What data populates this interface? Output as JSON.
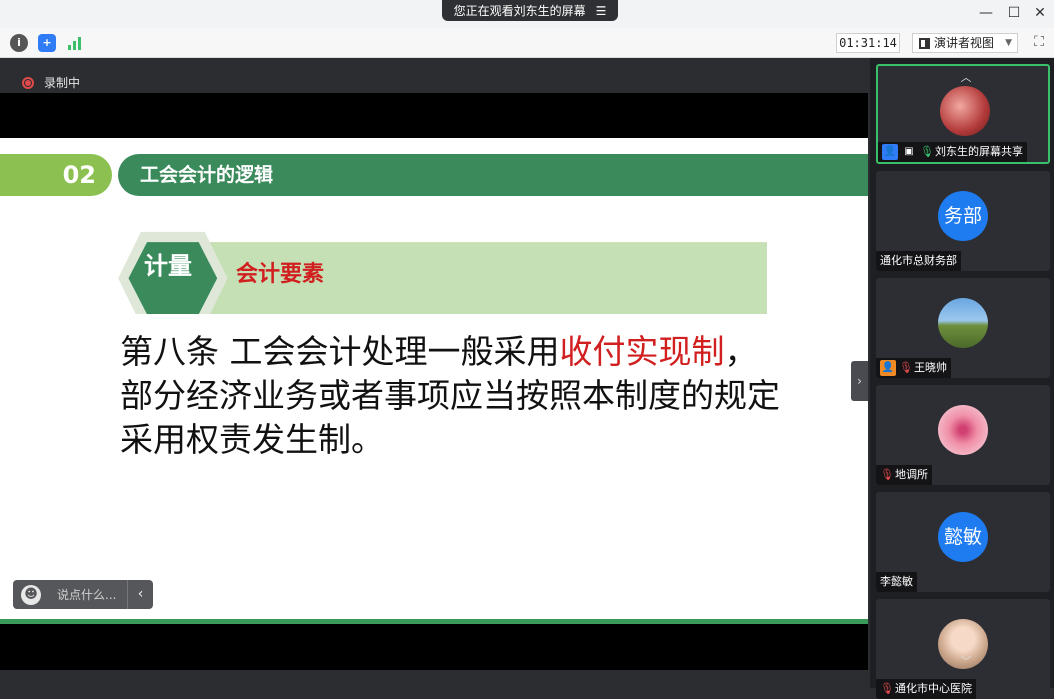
{
  "banner": {
    "text": "您正在观看刘东生的屏幕",
    "menu_icon": "menu-lines-icon"
  },
  "window_controls": {
    "minimize": "—",
    "maximize": "☐",
    "close": "✕"
  },
  "toolbar": {
    "timer": "01:31:14",
    "view_mode": "演讲者视图",
    "icons": [
      "info-icon",
      "shield-icon",
      "signal-icon",
      "fullscreen-icon"
    ]
  },
  "recording": {
    "label": "录制中"
  },
  "slide": {
    "section_number": "02",
    "section_title": "工会会计的逻辑",
    "hex_label": "计量",
    "subhead": "会计要素",
    "body_pre": "第八条 工会会计处理一般采用",
    "body_highlight": "收付实现制",
    "body_post": "，部分经济业务或者事项应当按照本制度的规定采用权责发生制。",
    "colors": {
      "green_light": "#8cc152",
      "green_dark": "#3a8a5c",
      "highlight_red": "#d11f1f"
    }
  },
  "comment": {
    "placeholder": "说点什么..."
  },
  "participants": [
    {
      "name": "刘东生的屏幕共享",
      "avatar_text": "",
      "active": true,
      "mic": "on",
      "host": true,
      "sharing": true
    },
    {
      "name": "通化市总财务部",
      "avatar_text": "务部",
      "mic": "none",
      "avatar_color": "#1e7bf0"
    },
    {
      "name": "王晓帅",
      "avatar_text": "",
      "mic": "muted",
      "host_orange": true
    },
    {
      "name": "地调所",
      "avatar_text": "",
      "mic": "muted"
    },
    {
      "name": "李懿敏",
      "avatar_text": "懿敏",
      "mic": "none",
      "avatar_color": "#1e7bf0"
    },
    {
      "name": "通化市中心医院",
      "avatar_text": "",
      "mic": "muted"
    }
  ]
}
